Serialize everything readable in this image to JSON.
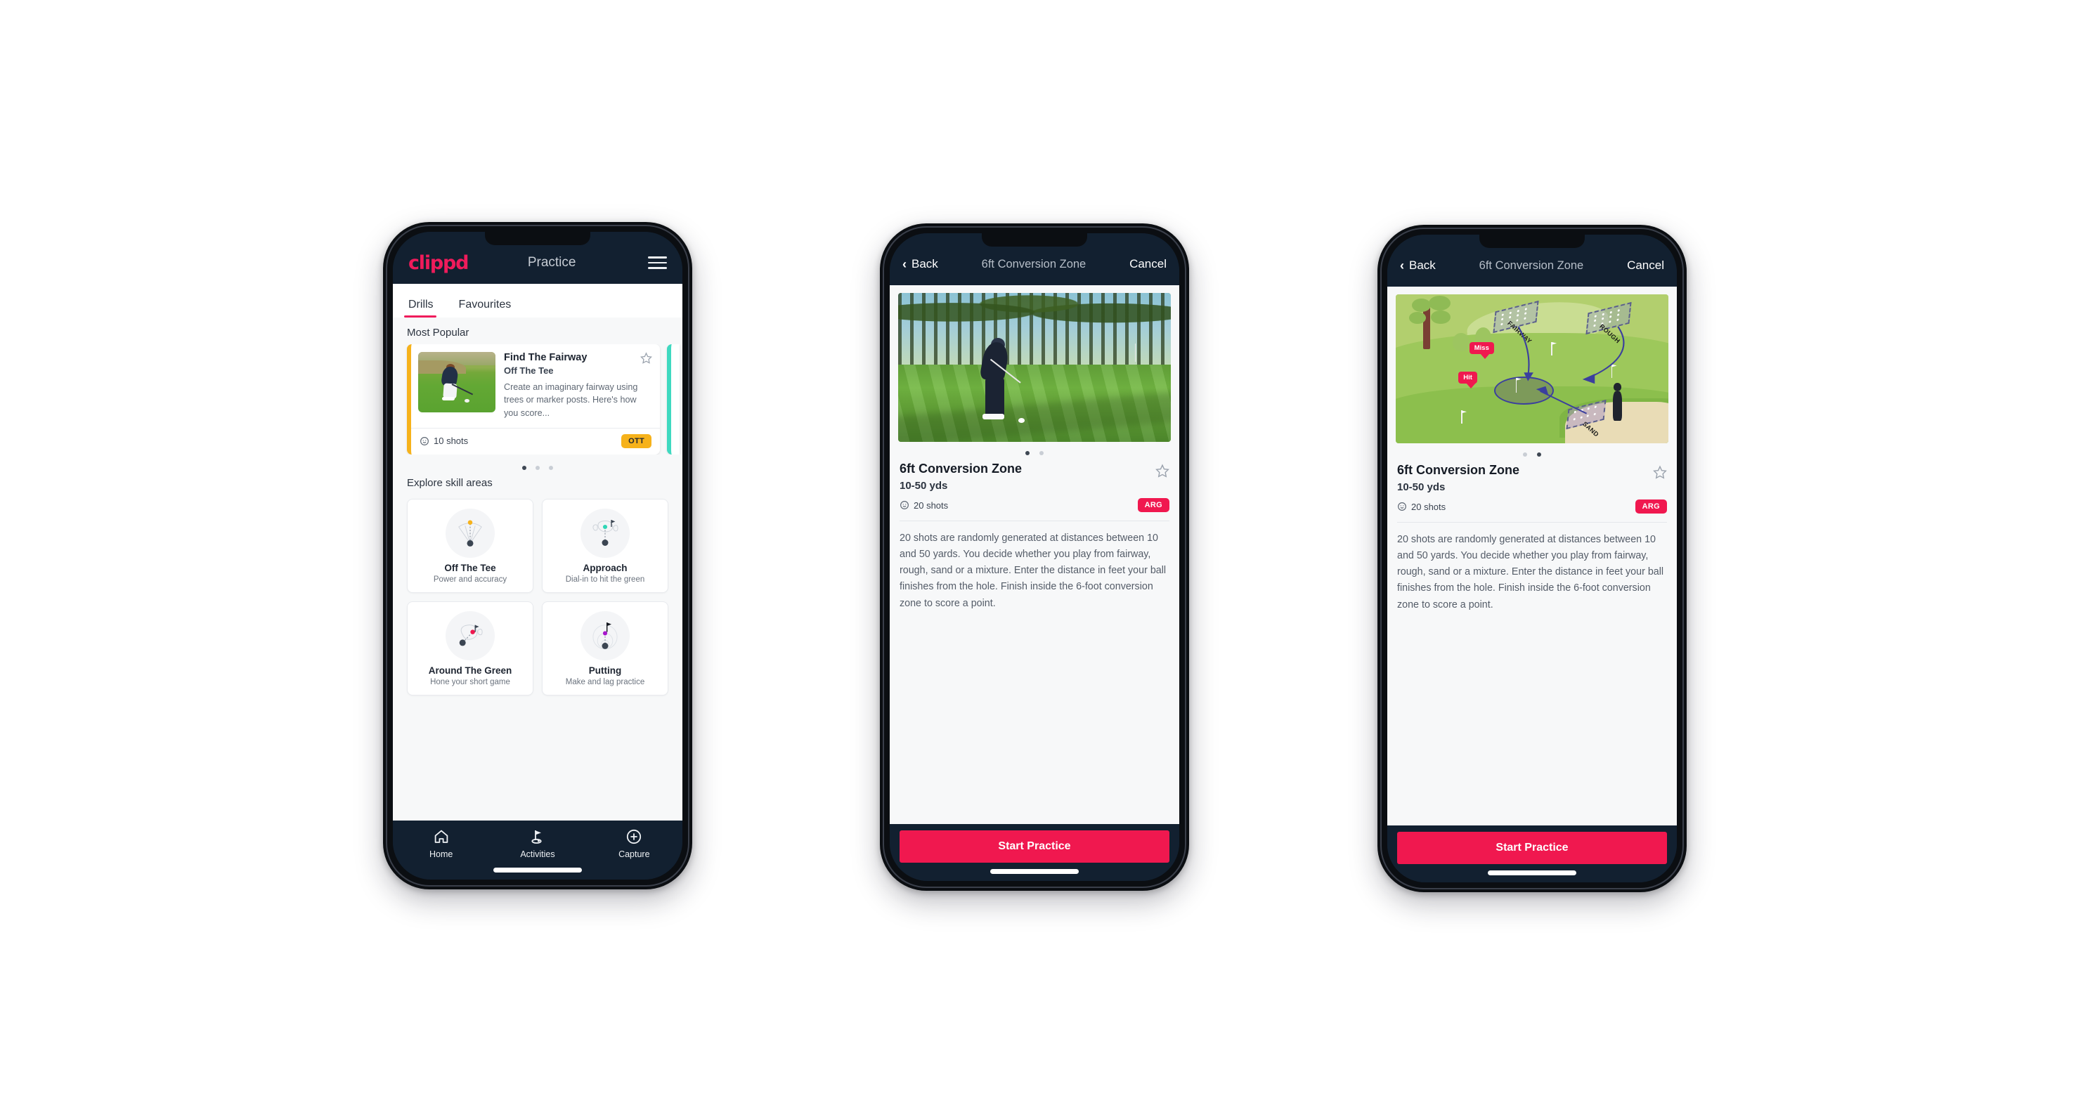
{
  "phone1": {
    "header": {
      "logo": "clippd",
      "title": "Practice",
      "menu_icon": "hamburger-icon"
    },
    "tabs": [
      {
        "label": "Drills",
        "active": true
      },
      {
        "label": "Favourites",
        "active": false
      }
    ],
    "section_most_popular": "Most Popular",
    "drill_card": {
      "name": "Find The Fairway",
      "category": "Off The Tee",
      "description": "Create an imaginary fairway using trees or marker posts. Here's how you score...",
      "shots": "10 shots",
      "badge": "OTT",
      "accent_color": "#f6b21b",
      "next_accent_color": "#3fd9c0"
    },
    "carousel_dots": {
      "count": 3,
      "active_index": 0
    },
    "section_skill_areas": "Explore skill areas",
    "skills": [
      {
        "name": "Off The Tee",
        "sub": "Power and accuracy",
        "icon": "tee-fan-icon",
        "dot_color": "#f6b21b"
      },
      {
        "name": "Approach",
        "sub": "Dial-in to hit the green",
        "icon": "approach-green-icon",
        "dot_color": "#2fd6b6"
      },
      {
        "name": "Around The Green",
        "sub": "Hone your short game",
        "icon": "around-green-icon",
        "dot_color": "#f0184f"
      },
      {
        "name": "Putting",
        "sub": "Make and lag practice",
        "icon": "putting-rings-icon",
        "dot_color": "#a716cc"
      }
    ],
    "bottom_nav": [
      {
        "label": "Home",
        "icon": "home-icon",
        "active": false
      },
      {
        "label": "Activities",
        "icon": "golf-flag-icon",
        "active": true
      },
      {
        "label": "Capture",
        "icon": "plus-circle-icon",
        "active": false
      }
    ]
  },
  "phone2": {
    "header": {
      "back": "Back",
      "title": "6ft Conversion Zone",
      "cancel": "Cancel"
    },
    "media_slide": "golf-chip-shot-photo",
    "carousel_dots": {
      "count": 2,
      "active_index": 0
    },
    "detail": {
      "title": "6ft Conversion Zone",
      "distance": "10-50 yds",
      "shots": "20 shots",
      "badge": "ARG",
      "description": "20 shots are randomly generated at distances between 10 and 50 yards. You decide whether you play from fairway, rough, sand or a mixture. Enter the distance in feet your ball finishes from the hole. Finish inside the 6-foot conversion zone to score a point."
    },
    "cta": "Start Practice"
  },
  "phone3": {
    "header": {
      "back": "Back",
      "title": "6ft Conversion Zone",
      "cancel": "Cancel"
    },
    "media_slide": "course-diagram-illustration",
    "illustration": {
      "zones": [
        "FAIRWAY",
        "ROUGH",
        "SAND"
      ],
      "tags": [
        "Miss",
        "Hit"
      ]
    },
    "carousel_dots": {
      "count": 2,
      "active_index": 1
    },
    "detail": {
      "title": "6ft Conversion Zone",
      "distance": "10-50 yds",
      "shots": "20 shots",
      "badge": "ARG",
      "description": "20 shots are randomly generated at distances between 10 and 50 yards. You decide whether you play from fairway, rough, sand or a mixture. Enter the distance in feet your ball finishes from the hole. Finish inside the 6-foot conversion zone to score a point."
    },
    "cta": "Start Practice"
  },
  "colors": {
    "brand_pink": "#ef1b5b",
    "cta_pink": "#f0184f",
    "dark_navy": "#122030",
    "amber": "#f6b21b",
    "teal": "#3fd9c0"
  }
}
